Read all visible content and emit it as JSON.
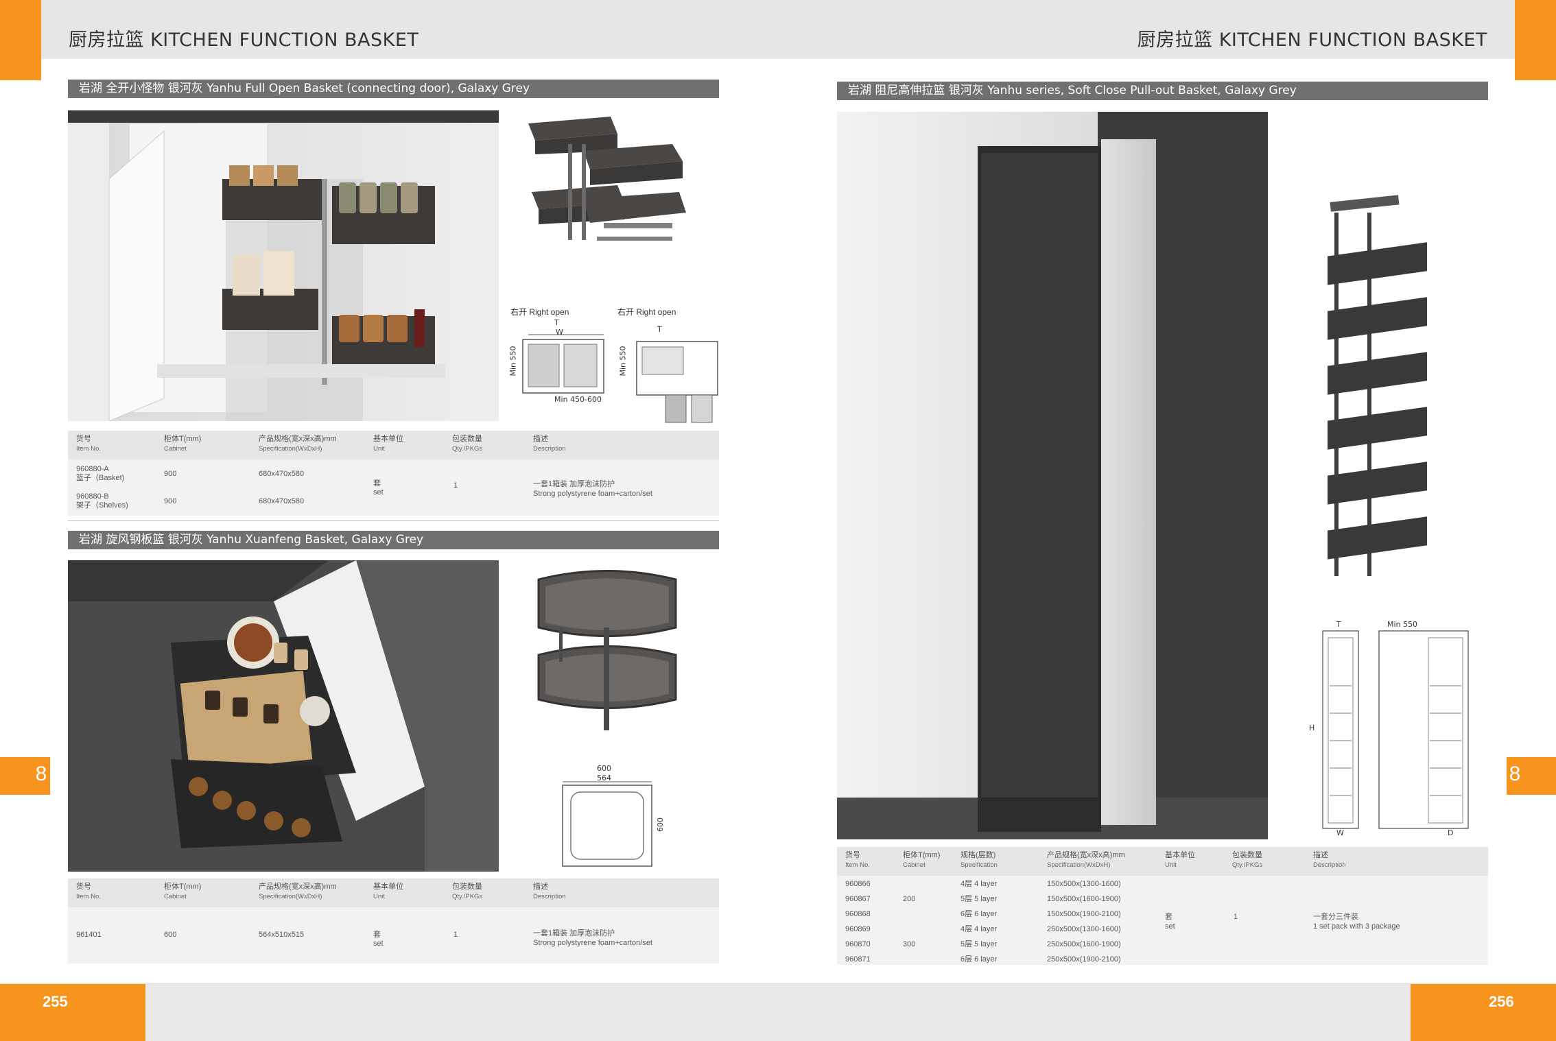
{
  "header": {
    "left_title": "厨房拉篮  KITCHEN FUNCTION BASKET",
    "right_title": "厨房拉篮  KITCHEN FUNCTION BASKET"
  },
  "footer": {
    "left_page": "255",
    "right_page": "256"
  },
  "side_tabs": {
    "left": "8",
    "right": "8"
  },
  "colors": {
    "accent": "#f7941d",
    "section_bar": "#707070",
    "table_bg": "#f2f2f2",
    "table_header_bg": "#e6e6e6",
    "header_band": "#e6e6e6"
  },
  "section1": {
    "title": "岩湖  全开小怪物  银河灰    Yanhu Full Open Basket (connecting door), Galaxy Grey",
    "diagram_labels": {
      "left_caption": "右开 Right open",
      "right_caption": "右开 Right open",
      "t": "T",
      "w": "W",
      "min550": "Min 550",
      "min450": "Min 450-600"
    },
    "table": {
      "headers": [
        {
          "zh": "货号",
          "en": "Item No."
        },
        {
          "zh": "柜体T(mm)",
          "en": "Cabinet"
        },
        {
          "zh": "产品规格(宽x深x高)mm",
          "en": "Specification(WxDxH)"
        },
        {
          "zh": "基本单位",
          "en": "Unit"
        },
        {
          "zh": "包装数量",
          "en": "Qty./PKGs"
        },
        {
          "zh": "描述",
          "en": "Description"
        }
      ],
      "rows": [
        {
          "item": "960880-A",
          "item_sub": "篮子（Basket)",
          "cabinet": "900",
          "spec": "680x470x580"
        },
        {
          "item": "960880-B",
          "item_sub": "架子（Shelves)",
          "cabinet": "900",
          "spec": "680x470x580"
        }
      ],
      "unit_zh": "套",
      "unit_en": "set",
      "qty": "1",
      "desc_zh": "一套1箱装 加厚泡沫防护",
      "desc_en": "Strong polystyrene foam+carton/set"
    }
  },
  "section2": {
    "title": "岩湖  旋风钢板篮  银河灰    Yanhu Xuanfeng Basket, Galaxy Grey",
    "diagram_labels": {
      "outer": "600",
      "inner": "564",
      "side": "600"
    },
    "table": {
      "headers": [
        {
          "zh": "货号",
          "en": "Item No."
        },
        {
          "zh": "柜体T(mm)",
          "en": "Cabinet"
        },
        {
          "zh": "产品规格(宽x深x高)mm",
          "en": "Specification(WxDxH)"
        },
        {
          "zh": "基本单位",
          "en": "Unit"
        },
        {
          "zh": "包装数量",
          "en": "Qty./PKGs"
        },
        {
          "zh": "描述",
          "en": "Description"
        }
      ],
      "row": {
        "item": "961401",
        "cabinet": "600",
        "spec": "564x510x515",
        "unit_zh": "套",
        "unit_en": "set",
        "qty": "1"
      },
      "desc_zh": "一套1箱装 加厚泡沫防护",
      "desc_en": "Strong polystyrene foam+carton/set"
    }
  },
  "section3": {
    "title": "岩湖  阻尼高伸拉篮  银河灰    Yanhu series, Soft Close Pull-out Basket, Galaxy Grey",
    "diagram_labels": {
      "t": "T",
      "min550": "Min 550",
      "h": "H",
      "w": "W",
      "d": "D"
    },
    "table": {
      "headers": [
        {
          "zh": "货号",
          "en": "Item No."
        },
        {
          "zh": "柜体T(mm)",
          "en": "Cabinet"
        },
        {
          "zh": "规格(层数)",
          "en": "Specification"
        },
        {
          "zh": "产品规格(宽x深x高)mm",
          "en": "Specification(WxDxH)"
        },
        {
          "zh": "基本单位",
          "en": "Unit"
        },
        {
          "zh": "包装数量",
          "en": "Qty./PKGs"
        },
        {
          "zh": "描述",
          "en": "Description"
        }
      ],
      "rows": [
        {
          "item": "960866",
          "layers": "4层   4 layer",
          "spec": "150x500x(1300-1600)"
        },
        {
          "item": "960867",
          "layers": "5层   5 layer",
          "spec": "150x500x(1600-1900)"
        },
        {
          "item": "960868",
          "layers": "6层   6 layer",
          "spec": "150x500x(1900-2100)"
        },
        {
          "item": "960869",
          "layers": "4层   4 layer",
          "spec": "250x500x(1300-1600)"
        },
        {
          "item": "960870",
          "layers": "5层   5 layer",
          "spec": "250x500x(1600-1900)"
        },
        {
          "item": "960871",
          "layers": "6层   6 layer",
          "spec": "250x500x(1900-2100)"
        }
      ],
      "cabinet_a": "200",
      "cabinet_b": "300",
      "unit_zh": "套",
      "unit_en": "set",
      "qty": "1",
      "desc_zh": "一套分三件装",
      "desc_en": "1 set pack with 3 package"
    }
  }
}
